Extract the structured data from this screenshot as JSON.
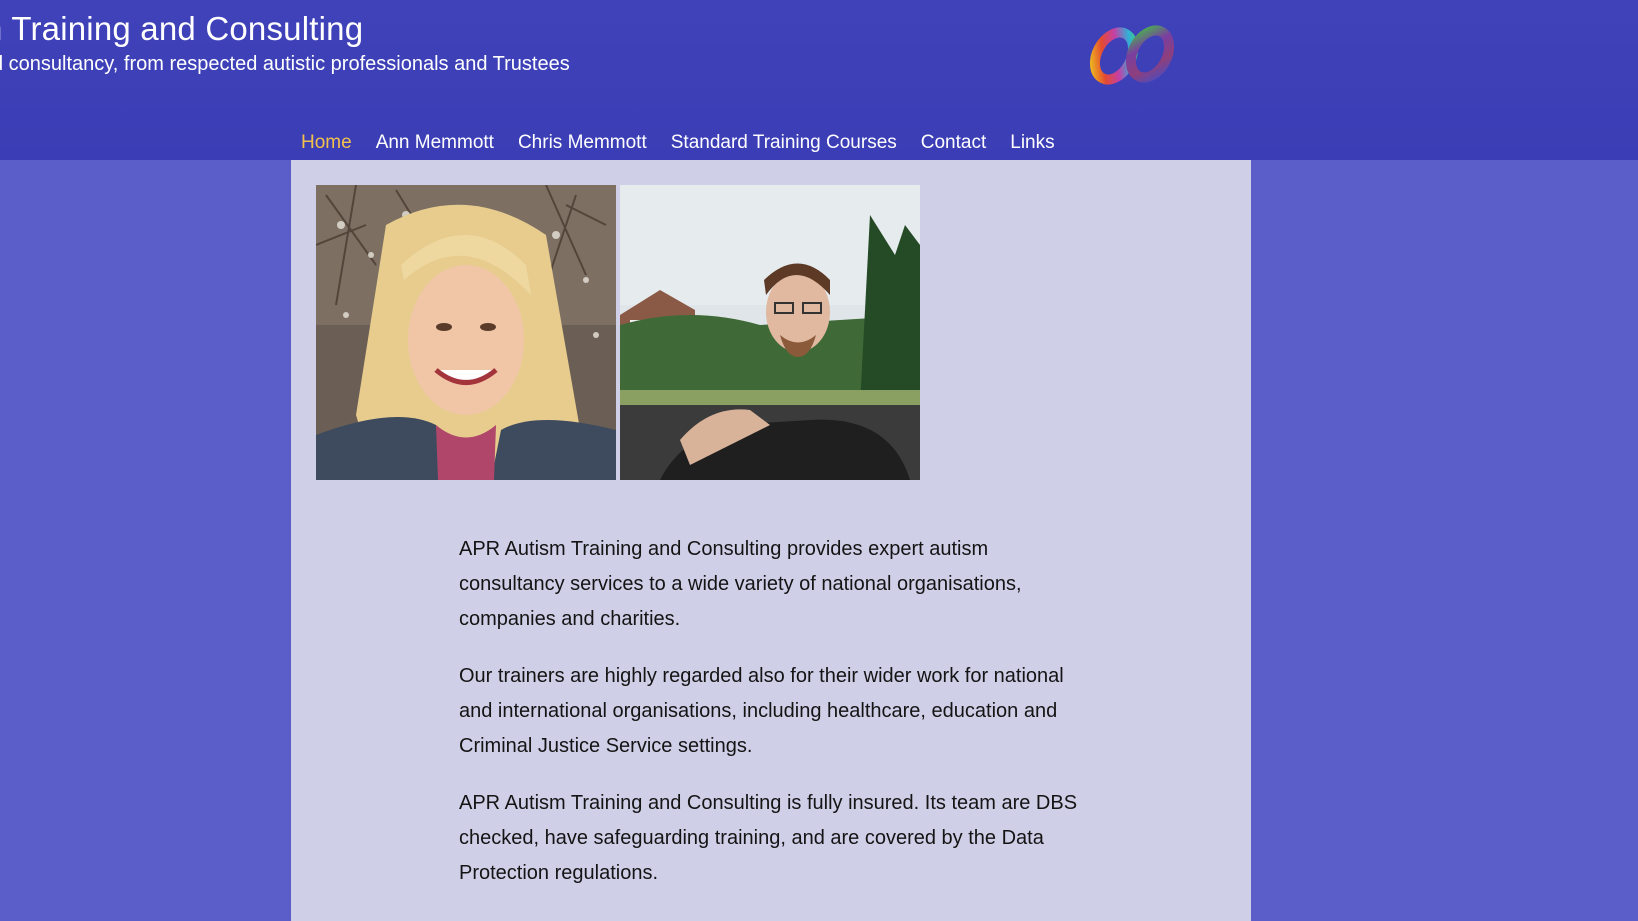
{
  "header": {
    "title": "n Training and Consulting",
    "tagline": "d consultancy, from respected autistic professionals and Trustees",
    "logo_icon": "rainbow-infinity-logo-icon"
  },
  "nav": {
    "items": [
      {
        "label": "Home",
        "active": true
      },
      {
        "label": "Ann Memmott",
        "active": false
      },
      {
        "label": "Chris Memmott",
        "active": false
      },
      {
        "label": "Standard Training Courses",
        "active": false
      },
      {
        "label": "Contact",
        "active": false
      },
      {
        "label": "Links",
        "active": false
      }
    ]
  },
  "main": {
    "paragraphs": [
      "APR Autism Training and Consulting provides expert autism consultancy services to a wide variety of national organisations, companies and charities.",
      "Our trainers are highly regarded also for their wider work for national and international organisations, including healthcare, education and Criminal Justice Service settings.",
      "APR Autism Training and Consulting is fully insured. Its team are DBS checked, have safeguarding training, and are covered by the Data Protection regulations."
    ]
  },
  "colors": {
    "header_bg": "#3f41b8",
    "page_bg": "#5b5ec9",
    "content_bg": "#cfcfe8",
    "nav_active": "#f2c14b",
    "nav_text": "#ffffff",
    "body_text": "#141414"
  }
}
